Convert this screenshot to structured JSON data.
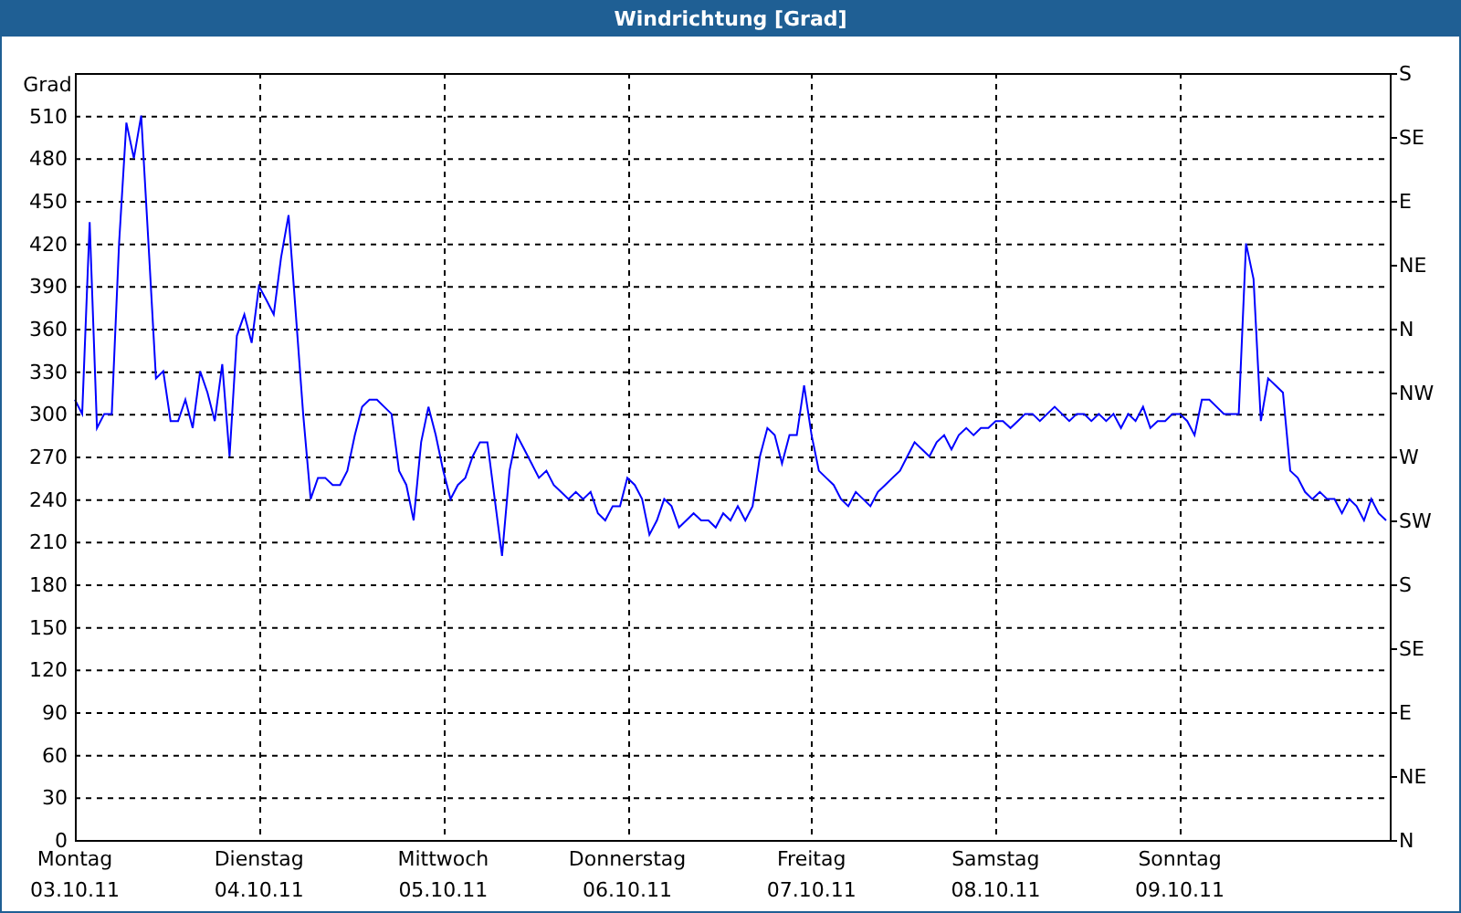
{
  "window": {
    "title": "Windrichtung [Grad]"
  },
  "chart": {
    "chart_data": {
      "type": "line",
      "ylabel": "Grad",
      "grid": true,
      "ylim": [
        0,
        540
      ],
      "yticks": [
        0,
        30,
        60,
        90,
        120,
        150,
        180,
        210,
        240,
        270,
        300,
        330,
        360,
        390,
        420,
        450,
        480,
        510
      ],
      "series": [
        {
          "color": "#0000ff",
          "values": [
            310,
            300,
            435,
            290,
            300,
            300,
            420,
            505,
            480,
            510,
            420,
            325,
            330,
            295,
            295,
            310,
            290,
            330,
            315,
            295,
            335,
            270,
            355,
            370,
            350,
            390,
            380,
            370,
            410,
            440,
            370,
            300,
            240,
            255,
            255,
            250,
            250,
            260,
            285,
            305,
            310,
            310,
            305,
            300,
            260,
            250,
            225,
            280,
            305,
            285,
            260,
            240,
            250,
            255,
            270,
            280,
            280,
            240,
            200,
            260,
            285,
            275,
            265,
            255,
            260,
            250,
            245,
            240,
            245,
            240,
            245,
            230,
            225,
            235,
            235,
            255,
            250,
            240,
            215,
            225,
            240,
            235,
            220,
            225,
            230,
            225,
            225,
            220,
            230,
            225,
            235,
            225,
            235,
            270,
            290,
            285,
            265,
            285,
            285,
            320,
            285,
            260,
            255,
            250,
            240,
            235,
            245,
            240,
            235,
            245,
            250,
            255,
            260,
            270,
            280,
            275,
            270,
            280,
            285,
            275,
            285,
            290,
            285,
            290,
            290,
            295,
            295,
            290,
            295,
            300,
            300,
            295,
            300,
            305,
            300,
            295,
            300,
            300,
            295,
            300,
            295,
            300,
            290,
            300,
            295,
            305,
            290,
            295,
            295,
            300,
            300,
            295,
            285,
            310,
            310,
            305,
            300,
            300,
            300,
            420,
            395,
            295,
            325,
            320,
            315,
            260,
            255,
            245,
            240,
            245,
            240,
            240,
            230,
            240,
            235,
            225,
            240,
            230,
            225
          ]
        }
      ],
      "categories": [
        "03.10.11",
        null,
        null,
        null,
        null,
        null,
        null,
        null,
        null,
        null,
        null,
        null,
        null,
        null,
        null,
        null,
        null,
        null,
        null,
        null,
        null,
        null,
        null,
        null,
        null,
        "04.10.11",
        null,
        null,
        null,
        null,
        null,
        null,
        null,
        null,
        null,
        null,
        null,
        null,
        null,
        null,
        null,
        null,
        null,
        null,
        null,
        null,
        null,
        null,
        null,
        null,
        "05.10.11",
        null,
        null,
        null,
        null,
        null,
        null,
        null,
        null,
        null,
        null,
        null,
        null,
        null,
        null,
        null,
        null,
        null,
        null,
        null,
        null,
        null,
        null,
        null,
        null,
        "06.10.11",
        null,
        null,
        null,
        null,
        null,
        null,
        null,
        null,
        null,
        null,
        null,
        null,
        null,
        null,
        null,
        null,
        null,
        null,
        null,
        null,
        null,
        null,
        null,
        null,
        "07.10.11",
        null,
        null,
        null,
        null,
        null,
        null,
        null,
        null,
        null,
        null,
        null,
        null,
        null,
        null,
        null,
        null,
        null,
        null,
        null,
        null,
        null,
        null,
        null,
        null,
        "08.10.11",
        null,
        null,
        null,
        null,
        null,
        null,
        null,
        null,
        null,
        null,
        null,
        null,
        null,
        null,
        null,
        null,
        null,
        null,
        null,
        null,
        null,
        null,
        null,
        null,
        "09.10.11",
        null,
        null,
        null,
        null,
        null,
        null,
        null,
        null,
        null,
        null,
        null,
        null,
        null,
        null,
        null,
        null,
        null,
        null,
        null,
        null,
        null,
        null,
        null,
        null,
        null,
        null,
        null,
        null
      ]
    },
    "weekday_labels": [
      "Montag",
      "Dienstag",
      "Mittwoch",
      "Donnerstag",
      "Freitag",
      "Samstag",
      "Sonntag"
    ],
    "compass_labels": [
      "S",
      "SE",
      "E",
      "NE",
      "N",
      "NW",
      "W",
      "SW",
      "S",
      "SE",
      "E",
      "NE",
      "N"
    ]
  }
}
